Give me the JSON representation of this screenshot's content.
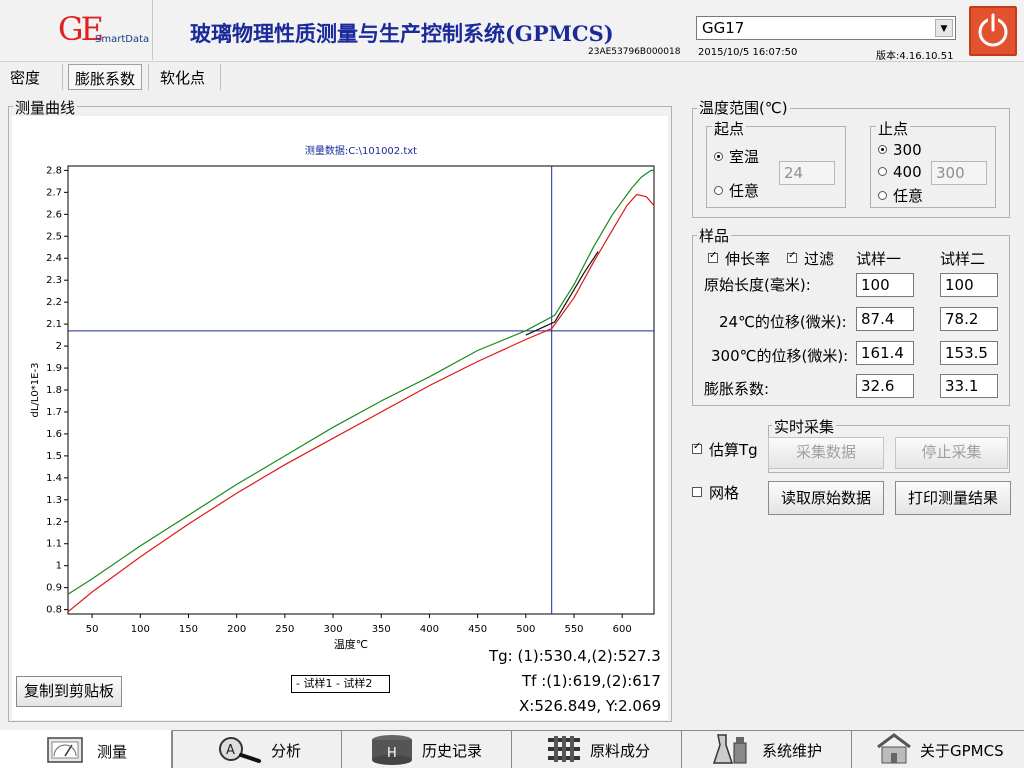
{
  "header": {
    "logo_letters": "GE",
    "logo_sub": "SmartData",
    "title": "玻璃物理性质测量与生产控制系统(GPMCS)",
    "serial": "23AE53796B000018",
    "model": "GG17",
    "datetime": "2015/10/5 16:07:50",
    "version": "版本:4.16.10.51"
  },
  "tabs": [
    {
      "label": "密度"
    },
    {
      "label": "膨胀系数"
    },
    {
      "label": "软化点"
    }
  ],
  "curve": {
    "group_label": "测量曲线",
    "copy_button": "复制到剪贴板",
    "tg_text": "Tg: (1):530.4,(2):527.3",
    "tf_text": "Tf :(1):619,(2):617",
    "xy_text": "X:526.849, Y:2.069"
  },
  "chart_data": {
    "type": "line",
    "title": "测量数据:C:\\101002.txt",
    "xlabel": "温度℃",
    "ylabel": "dL/L0*1E-3",
    "xlim": [
      25,
      633
    ],
    "ylim": [
      0.78,
      2.82
    ],
    "xticks": [
      50,
      100,
      150,
      200,
      250,
      300,
      350,
      400,
      450,
      500,
      550,
      600
    ],
    "yticks": [
      "0.8",
      "0.9",
      "1",
      "1.1",
      "1.2",
      "1.3",
      "1.4",
      "1.5",
      "1.6",
      "1.7",
      "1.8",
      "1.9",
      "2",
      "2.1",
      "2.2",
      "2.3",
      "2.4",
      "2.5",
      "2.6",
      "2.7",
      "2.8"
    ],
    "cursor": {
      "x": 526.849,
      "y": 2.069
    },
    "legend": "- 试样1 - 试样2",
    "series": [
      {
        "name": "试样1",
        "color": "#1a8a1a",
        "x": [
          25,
          50,
          100,
          150,
          200,
          250,
          300,
          350,
          400,
          450,
          500,
          530,
          550,
          570,
          590,
          610,
          620,
          630,
          633
        ],
        "y": [
          0.87,
          0.94,
          1.09,
          1.23,
          1.37,
          1.5,
          1.63,
          1.75,
          1.86,
          1.98,
          2.07,
          2.14,
          2.28,
          2.45,
          2.6,
          2.72,
          2.77,
          2.8,
          2.8
        ]
      },
      {
        "name": "试样2",
        "color": "#e01818",
        "x": [
          25,
          50,
          100,
          150,
          200,
          250,
          300,
          350,
          400,
          450,
          500,
          527,
          550,
          570,
          590,
          605,
          615,
          625,
          633
        ],
        "y": [
          0.79,
          0.88,
          1.04,
          1.19,
          1.33,
          1.46,
          1.58,
          1.7,
          1.82,
          1.93,
          2.03,
          2.08,
          2.22,
          2.38,
          2.53,
          2.64,
          2.69,
          2.68,
          2.64
        ]
      },
      {
        "name": "",
        "color": "#111111",
        "x": [
          500,
          520,
          530,
          545,
          560,
          575
        ],
        "y": [
          2.05,
          2.09,
          2.11,
          2.22,
          2.33,
          2.43
        ]
      }
    ]
  },
  "temp_range": {
    "label": "温度范围(℃)",
    "start_label": "起点",
    "start_opt_room": "室温",
    "start_opt_any": "任意",
    "start_value": "24",
    "end_label": "止点",
    "end_opt_300": "300",
    "end_opt_400": "400",
    "end_opt_any": "任意",
    "end_value": "300"
  },
  "sample": {
    "label": "样品",
    "chk_elongation": "伸长率",
    "chk_filter": "过滤",
    "col1": "试样一",
    "col2": "试样二",
    "row_length": "原始长度(毫米):",
    "row_disp24": "24℃的位移(微米):",
    "row_disp300": "300℃的位移(微米):",
    "row_coef": "膨胀系数:",
    "s1_length": "100",
    "s2_length": "100",
    "s1_disp24": "87.4",
    "s2_disp24": "78.2",
    "s1_disp300": "161.4",
    "s2_disp300": "153.5",
    "s1_coef": "32.6",
    "s2_coef": "33.1"
  },
  "options": {
    "estimate_tg": "估算Tg",
    "grid": "网格"
  },
  "acquisition": {
    "label": "实时采集",
    "start": "采集数据",
    "stop": "停止采集"
  },
  "actions": {
    "read_raw": "读取原始数据",
    "print": "打印测量结果"
  },
  "nav": [
    {
      "label": "测量",
      "icon": "gauge-icon"
    },
    {
      "label": "分析",
      "icon": "magnifier-icon"
    },
    {
      "label": "历史记录",
      "icon": "database-icon"
    },
    {
      "label": "原料成分",
      "icon": "molecule-icon"
    },
    {
      "label": "系统维护",
      "icon": "flask-icon"
    },
    {
      "label": "关于GPMCS",
      "icon": "house-icon"
    }
  ]
}
